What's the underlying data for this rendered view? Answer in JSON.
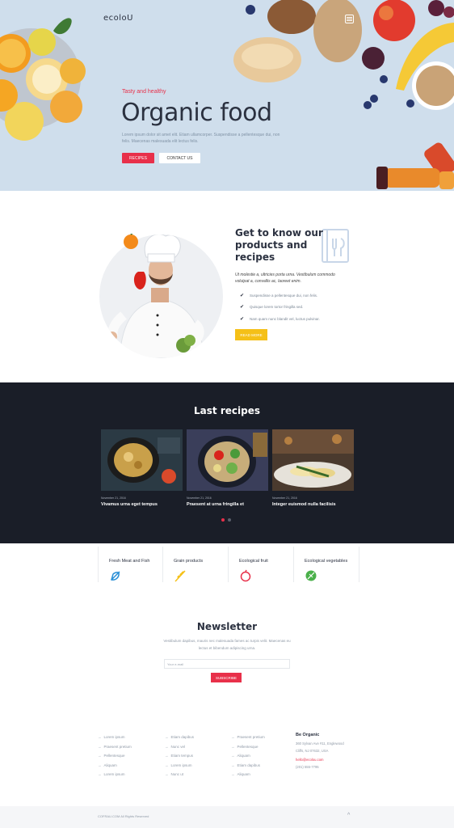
{
  "header": {
    "logo": "ecoloU",
    "menu_icon": "hamburger-icon"
  },
  "hero": {
    "kicker": "Tasty and healthy",
    "title": "Organic food",
    "text": "Lorem ipsum dolor sit amet elit. Etiam ullamcorper. Suspendisse a pellentesque dui, non felis. Maecenas malesuada elit lectus felis.",
    "btn_recipes": "RECIPES",
    "btn_contact": "CONTACT US"
  },
  "about": {
    "title": "Get to know our products and recipes",
    "text": "Ut molestie a, ultricies porta urna. Vestibulum commodo volutpat a, convallis ac, laoreet enim.",
    "checks": [
      "Suspendisse a pellentesque dui, non felis.",
      "Quisque lorem tortor fringilla sed.",
      "Nam quam nunc blandit vel, luctus pulvinar."
    ],
    "button": "READ MORE"
  },
  "recipes": {
    "title": "Last recipes",
    "cards": [
      {
        "date": "November 21, 2016",
        "title": "Vivamus urna eget tempus"
      },
      {
        "date": "November 21, 2016",
        "title": "Praesent at urna fringilla et"
      },
      {
        "date": "November 21, 2016",
        "title": "Integer euismod nulla facilisis"
      }
    ]
  },
  "categories": [
    {
      "label": "Fresh Meat and Fish",
      "icon": "fish-icon"
    },
    {
      "label": "Grain products",
      "icon": "grain-icon"
    },
    {
      "label": "Ecological fruit",
      "icon": "apple-icon"
    },
    {
      "label": "Ecological vegetables",
      "icon": "leaf-icon"
    }
  ],
  "newsletter": {
    "title": "Newsletter",
    "text": "Vestibulum dapibus, mauris nec malesuada fames ac turpis velit. Maecenas eu lectus et bibendum adipiscing urna.",
    "placeholder": "Your e-mail",
    "button": "SUBSCRIBE"
  },
  "footer": {
    "col1": [
      "Lorem ipsum",
      "Praesent pretium",
      "Pellentesque",
      "Aliquam",
      "Lorem ipsum"
    ],
    "col2": [
      "Etiam dapibus",
      "Nunc vel",
      "Etiam tempus",
      "Lorem ipsum",
      "Nunc ut"
    ],
    "col3": [
      "Praesent pretium",
      "Pellentesque",
      "Aliquam",
      "Etiam dapibus",
      "Aliquam"
    ],
    "contact_title": "Be Organic",
    "address": "360 Sylvan Ave #11, Englewood Cliffs, NJ 07632, USA",
    "email": "hello@ecolou.com",
    "phone": "(201) 555-7795",
    "copyright": "COFRAU.COM All Rights Reserved"
  },
  "colors": {
    "accent": "#e8304a",
    "yellow": "#f5c018",
    "dark": "#1a1e28",
    "hero_bg": "#cfdeec"
  }
}
